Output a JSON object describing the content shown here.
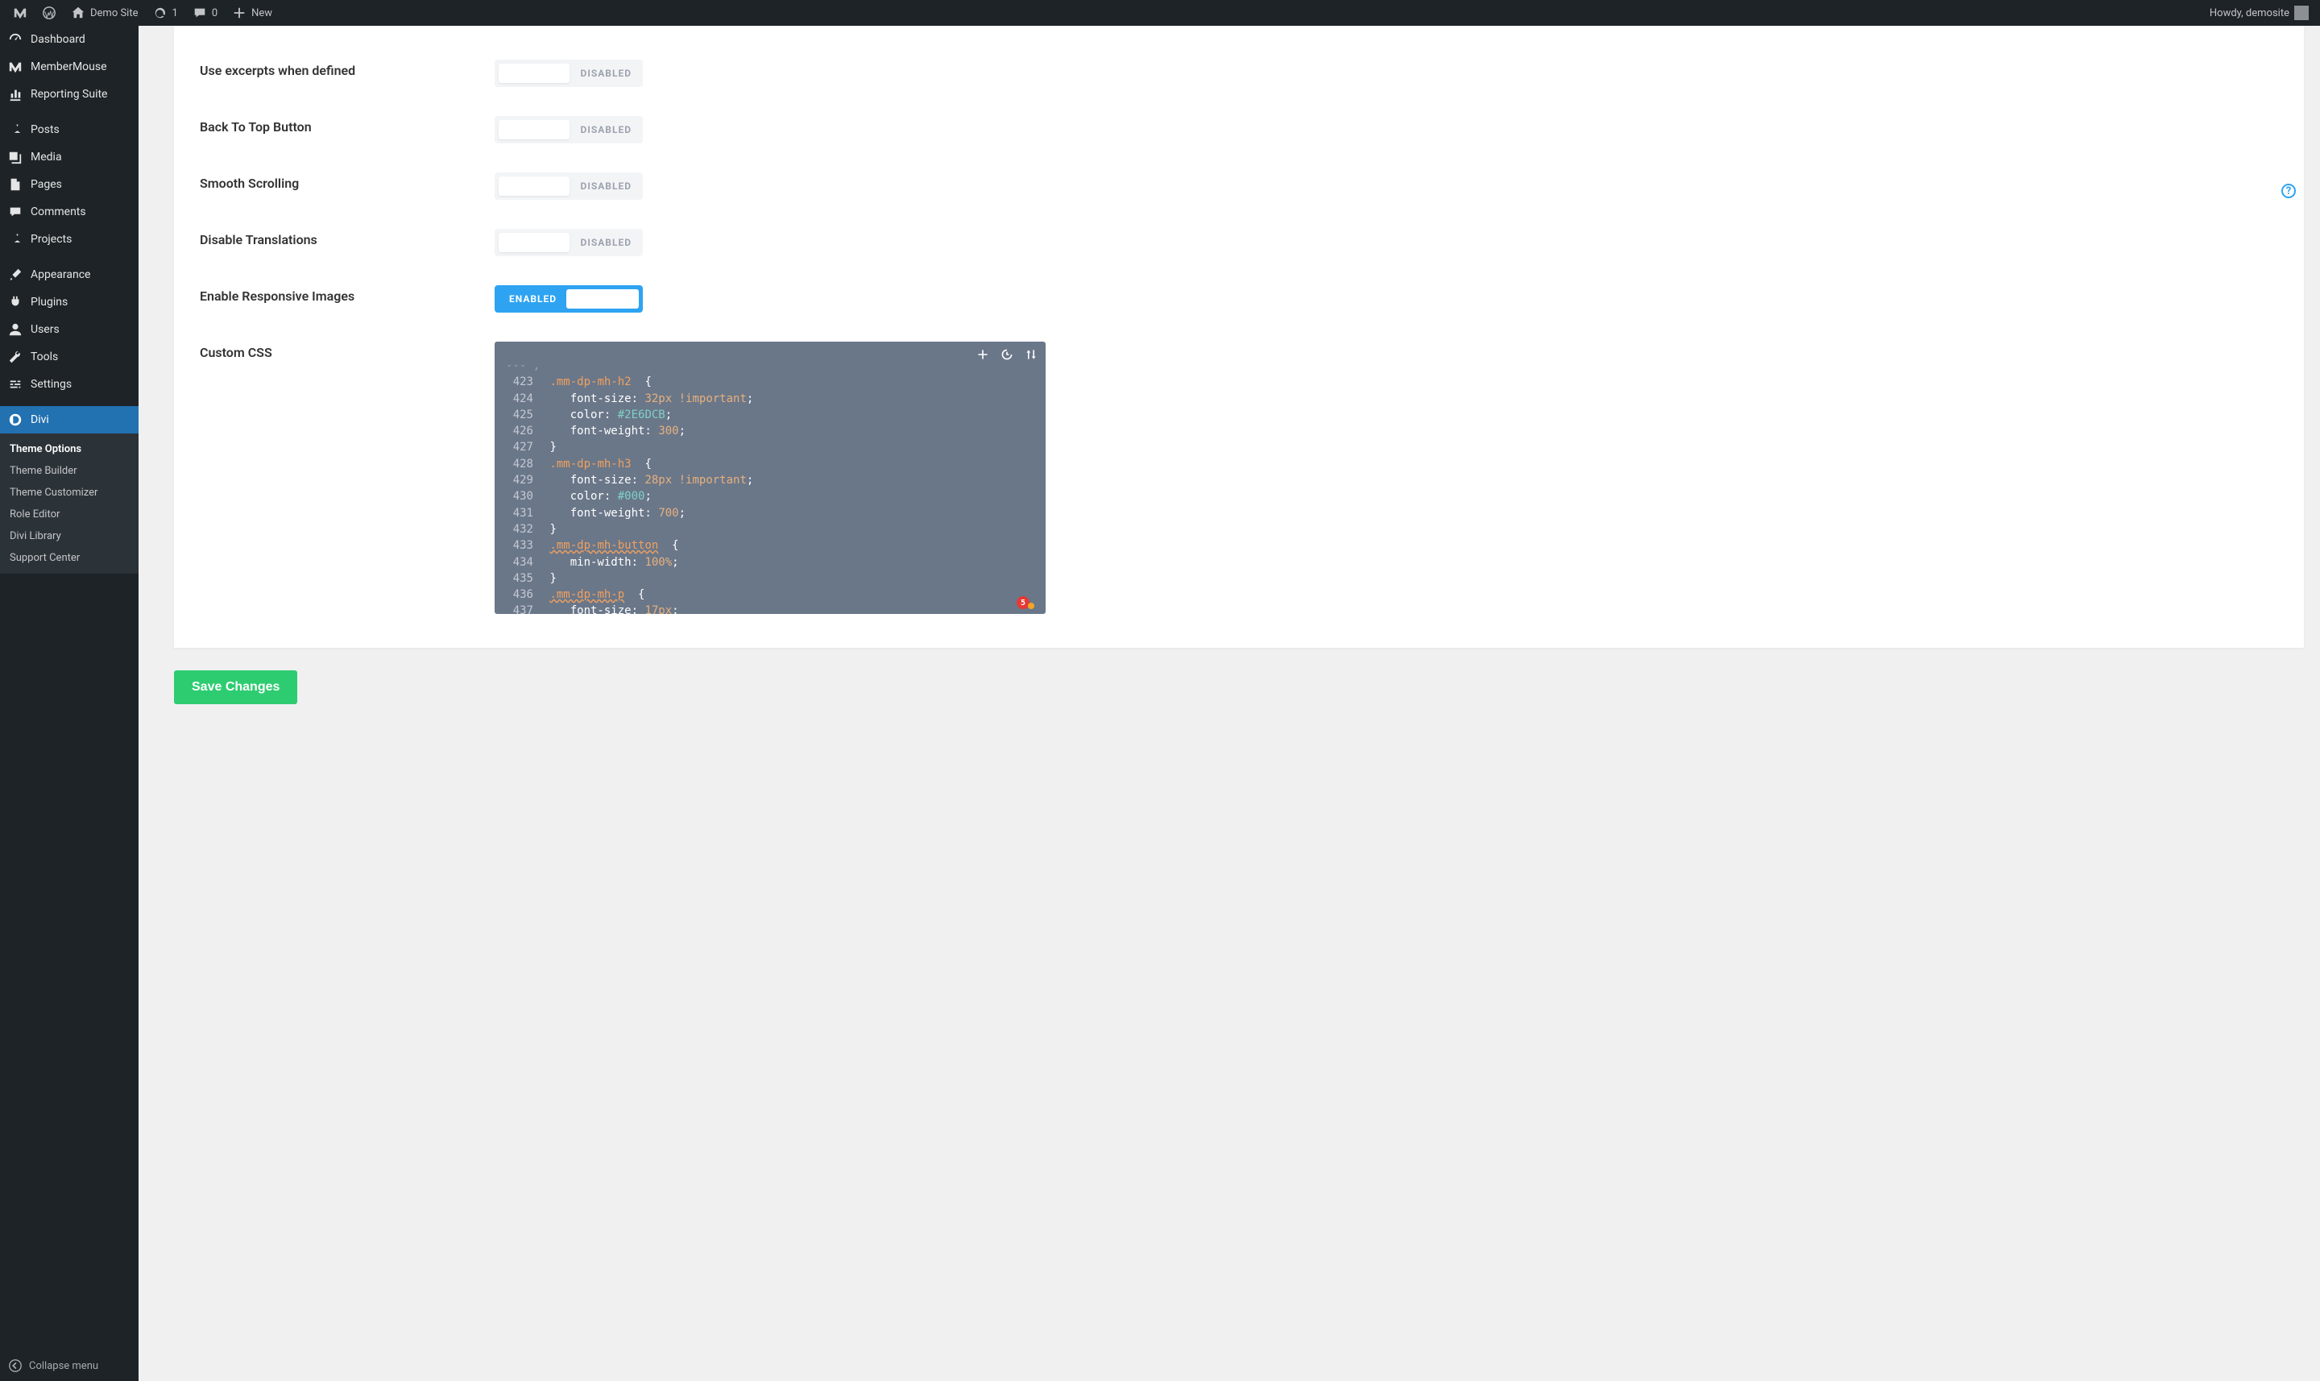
{
  "adminbar": {
    "site_name": "Demo Site",
    "updates": "1",
    "comments": "0",
    "new": "New",
    "howdy": "Howdy, demosite"
  },
  "sidebar": {
    "items": [
      {
        "label": "Dashboard"
      },
      {
        "label": "MemberMouse"
      },
      {
        "label": "Reporting Suite"
      },
      {
        "label": "Posts"
      },
      {
        "label": "Media"
      },
      {
        "label": "Pages"
      },
      {
        "label": "Comments"
      },
      {
        "label": "Projects"
      },
      {
        "label": "Appearance"
      },
      {
        "label": "Plugins"
      },
      {
        "label": "Users"
      },
      {
        "label": "Tools"
      },
      {
        "label": "Settings"
      },
      {
        "label": "Divi"
      }
    ],
    "submenu": [
      {
        "label": "Theme Options"
      },
      {
        "label": "Theme Builder"
      },
      {
        "label": "Theme Customizer"
      },
      {
        "label": "Role Editor"
      },
      {
        "label": "Divi Library"
      },
      {
        "label": "Support Center"
      }
    ],
    "collapse": "Collapse menu"
  },
  "options": [
    {
      "label": "Use excerpts when defined",
      "state": "DISABLED",
      "enabled": false
    },
    {
      "label": "Back To Top Button",
      "state": "DISABLED",
      "enabled": false
    },
    {
      "label": "Smooth Scrolling",
      "state": "DISABLED",
      "enabled": false
    },
    {
      "label": "Disable Translations",
      "state": "DISABLED",
      "enabled": false
    },
    {
      "label": "Enable Responsive Images",
      "state": "ENABLED",
      "enabled": true
    },
    {
      "label": "Custom CSS"
    }
  ],
  "code": {
    "lines": [
      {
        "n": "423",
        "sel": ".mm-dp-mh-h2",
        "open": true
      },
      {
        "n": "424",
        "prop": "font-size",
        "val": "32px",
        "imp": true
      },
      {
        "n": "425",
        "prop": "color",
        "hex": "#2E6DCB"
      },
      {
        "n": "426",
        "prop": "font-weight",
        "val": "300"
      },
      {
        "n": "427",
        "close": true
      },
      {
        "n": "428",
        "sel": ".mm-dp-mh-h3",
        "open": true
      },
      {
        "n": "429",
        "prop": "font-size",
        "val": "28px",
        "imp": true
      },
      {
        "n": "430",
        "prop": "color",
        "hex": "#000"
      },
      {
        "n": "431",
        "prop": "font-weight",
        "val": "700"
      },
      {
        "n": "432",
        "close": true
      },
      {
        "n": "433",
        "sel": ".mm-dp-mh-button",
        "open": true,
        "underline": true
      },
      {
        "n": "434",
        "prop": "min-width",
        "val": "100%"
      },
      {
        "n": "435",
        "close": true
      },
      {
        "n": "436",
        "sel": ".mm-dp-mh-p",
        "open": true,
        "underline": true
      },
      {
        "n": "437",
        "prop": "font-size",
        "val": "17px"
      }
    ],
    "error_count": "5"
  },
  "save_label": "Save Changes",
  "help_tooltip": "?"
}
